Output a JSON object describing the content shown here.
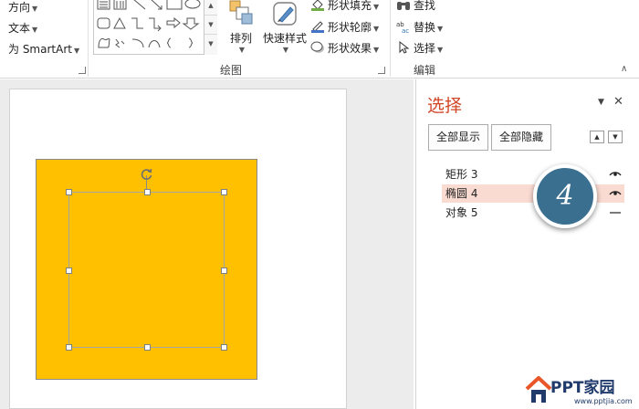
{
  "ribbon": {
    "text_group": {
      "direction": "方向",
      "text_align": "文本",
      "smartart": "为 SmartArt"
    },
    "drawing_group": {
      "label": "绘图",
      "arrange": "排列",
      "quick_styles": "快速样式",
      "shape_fill": "形状填充",
      "shape_outline": "形状轮廓",
      "shape_effects": "形状效果"
    },
    "editing_group": {
      "label": "编辑",
      "find": "查找",
      "replace": "替换",
      "select": "选择"
    }
  },
  "selection_pane": {
    "title": "选择",
    "show_all": "全部显示",
    "hide_all": "全部隐藏",
    "items": [
      {
        "name": "矩形 3",
        "visible": true,
        "selected": false
      },
      {
        "name": "椭圆 4",
        "visible": true,
        "selected": true
      },
      {
        "name": "对象 5",
        "visible": false,
        "selected": false
      }
    ]
  },
  "step_badge": "4",
  "watermark": {
    "title": "PPT家园",
    "url": "www.pptjia.com"
  },
  "colors": {
    "shape_fill": "#ffc000",
    "pane_title": "#d24726",
    "selected_row": "#fadbd2",
    "badge": "#3a6f90"
  }
}
